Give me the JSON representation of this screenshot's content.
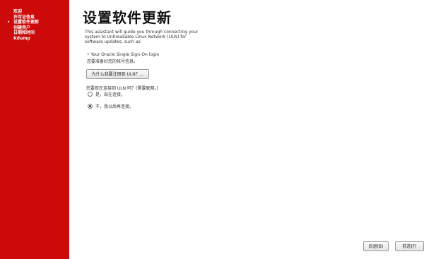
{
  "sidebar": {
    "items": [
      {
        "label": "欢迎"
      },
      {
        "label": "许可证信息"
      },
      {
        "label": "设置软件更新",
        "current": true,
        "marker": "▸"
      },
      {
        "label": "创建用户"
      },
      {
        "label": "日期和时间"
      },
      {
        "label": "Kdump"
      }
    ]
  },
  "main": {
    "title": "设置软件更新",
    "intro": "This assistant will guide you through connecting your system to Unbreakable Linux Network (ULN) for software updates, such as:",
    "bullet": "• Your Oracle Single Sign-On login",
    "note": "您要准备好您的帐号信息。",
    "what_is_uln_button": "为什么我要注册到 ULN？...",
    "question": "您要现在连接到 ULN 吗？(需要联网。)",
    "options": [
      {
        "label": "是，现在连接。",
        "selected": false
      },
      {
        "label": "不，我以后再连接。",
        "selected": true
      }
    ]
  },
  "footer": {
    "back_label": "后退(B)",
    "forward_label": "前进(F)"
  }
}
